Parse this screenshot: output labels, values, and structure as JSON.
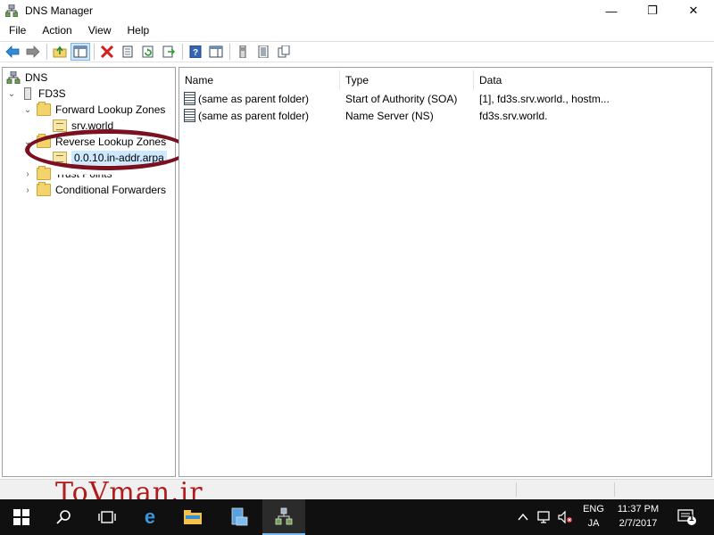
{
  "window": {
    "title": "DNS Manager",
    "controls": {
      "minimize": "—",
      "maximize": "❐",
      "close": "✕"
    }
  },
  "menu": [
    "File",
    "Action",
    "View",
    "Help"
  ],
  "toolbar": {
    "buttons": [
      "back-arrow-icon",
      "forward-arrow-icon",
      "up-folder-icon",
      "show-hide-console-tree-icon",
      "delete-icon",
      "properties-icon",
      "refresh-icon",
      "export-list-icon",
      "help-icon",
      "show-hide-action-pane-icon",
      "server-icon",
      "list-icon",
      "copy-icon"
    ]
  },
  "tree": {
    "root": "DNS",
    "server": "FD3S",
    "forward_zones": "Forward Lookup Zones",
    "forward_child": "srv.world",
    "reverse_zones": "Reverse Lookup Zones",
    "reverse_child": "0.0.10.in-addr.arpa",
    "trust_points": "Trust Points",
    "conditional_forwarders": "Conditional Forwarders"
  },
  "list": {
    "columns": [
      "Name",
      "Type",
      "Data"
    ],
    "rows": [
      {
        "name": "(same as parent folder)",
        "type": "Start of Authority (SOA)",
        "data": "[1], fd3s.srv.world., hostm..."
      },
      {
        "name": "(same as parent folder)",
        "type": "Name Server (NS)",
        "data": "fd3s.srv.world."
      }
    ]
  },
  "watermark": "ToVman.ir",
  "taskbar": {
    "items": [
      "windows-start-icon",
      "search-icon",
      "task-view-icon",
      "edge-browser-icon",
      "file-explorer-icon",
      "server-manager-icon",
      "dns-manager-icon"
    ],
    "lang_top": "ENG",
    "lang_bottom": "JA",
    "time": "11:37 PM",
    "date": "2/7/2017",
    "notification_count": "1"
  },
  "colors": {
    "annotation": "#7a1020",
    "watermark": "#b01c1c",
    "taskbar": "#101010",
    "selection": "#cde8ff"
  }
}
